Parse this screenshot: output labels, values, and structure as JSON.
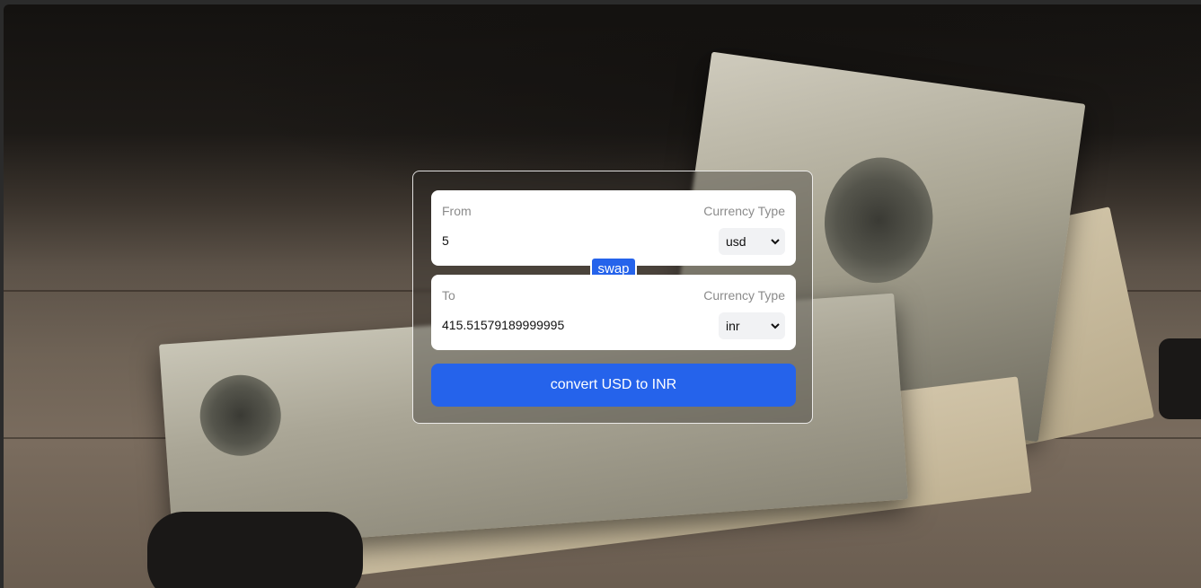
{
  "converter": {
    "from": {
      "label": "From",
      "currency_type_label": "Currency Type",
      "amount": "5",
      "currency": "usd"
    },
    "to": {
      "label": "To",
      "currency_type_label": "Currency Type",
      "amount": "415.51579189999995",
      "currency": "inr"
    },
    "swap_label": "swap",
    "convert_label": "convert USD to INR"
  },
  "colors": {
    "accent": "#2563eb",
    "card_border": "#ffffff",
    "label_text": "#8b8b8b"
  },
  "icons": {
    "select_arrow": "chevron-down-icon"
  }
}
